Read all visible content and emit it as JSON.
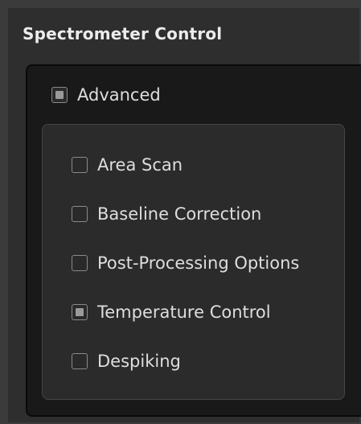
{
  "panel": {
    "title": "Spectrometer Control"
  },
  "advanced": {
    "label": "Advanced",
    "state": "partial"
  },
  "options": [
    {
      "label": "Area Scan",
      "state": "unchecked"
    },
    {
      "label": "Baseline Correction",
      "state": "unchecked"
    },
    {
      "label": "Post-Processing Options",
      "state": "unchecked"
    },
    {
      "label": "Temperature Control",
      "state": "partial"
    },
    {
      "label": "Despiking",
      "state": "unchecked"
    }
  ],
  "colors": {
    "background": "#3b3b3b",
    "panel": "#2e2e2e",
    "group_frame": "#191919",
    "inner_group": "#2b2b2b",
    "text": "#dedede",
    "title_text": "#ececec",
    "checkbox_border": "#8a8a8a",
    "checkbox_mark": "#9a9a9a"
  },
  "icons": {
    "checkbox_partial": "checkbox-partial-icon",
    "checkbox_unchecked": "checkbox-empty-icon"
  }
}
